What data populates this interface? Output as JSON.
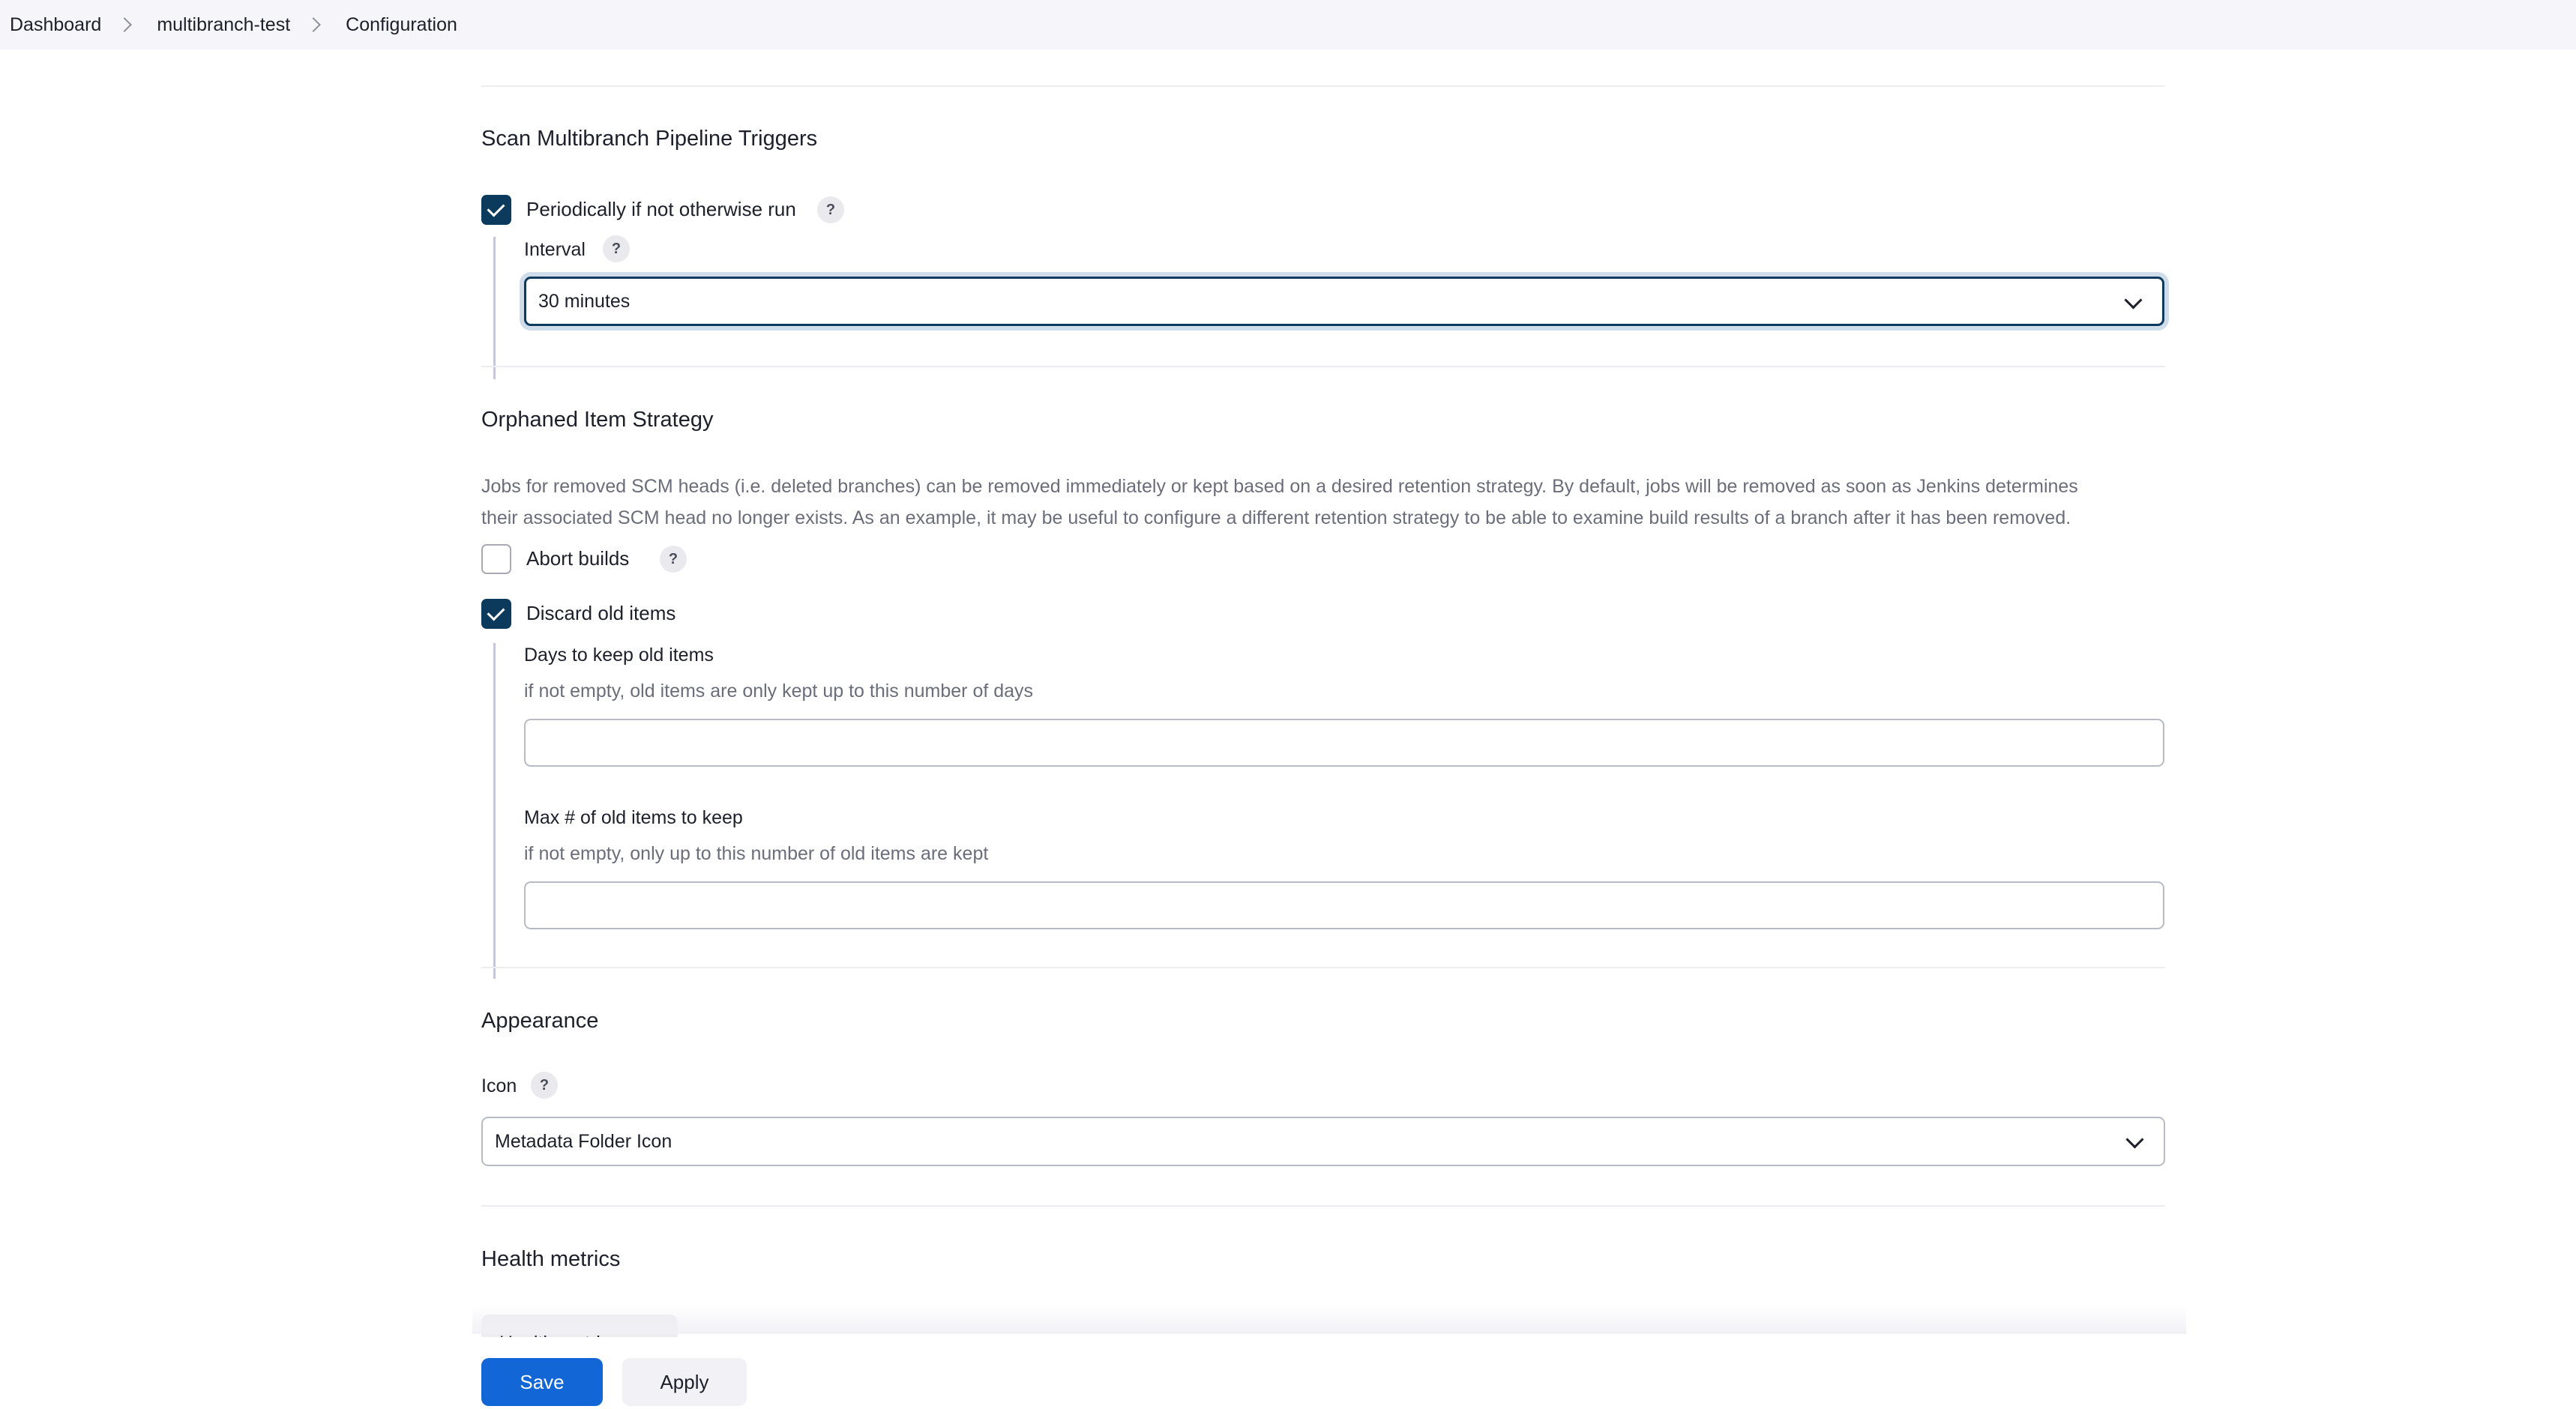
{
  "breadcrumb": {
    "items": [
      "Dashboard",
      "multibranch-test",
      "Configuration"
    ]
  },
  "scan_triggers": {
    "title": "Scan Multibranch Pipeline Triggers",
    "periodic_label": "Periodically if not otherwise run",
    "periodic_checked": true,
    "interval_label": "Interval",
    "interval_value": "30 minutes"
  },
  "orphaned": {
    "title": "Orphaned Item Strategy",
    "description_line1": "Jobs for removed SCM heads (i.e. deleted branches) can be removed immediately or kept based on a desired retention strategy. By default, jobs will be removed as soon as Jenkins determines",
    "description_line2": "their associated SCM head no longer exists. As an example, it may be useful to configure a different retention strategy to be able to examine build results of a branch after it has been removed.",
    "abort_label": "Abort builds",
    "abort_checked": false,
    "discard_label": "Discard old items",
    "discard_checked": true,
    "days_label": "Days to keep old items",
    "days_desc": "if not empty, old items are only kept up to this number of days",
    "days_value": "",
    "max_label": "Max # of old items to keep",
    "max_desc": "if not empty, only up to this number of old items are kept",
    "max_value": ""
  },
  "appearance": {
    "title": "Appearance",
    "icon_label": "Icon",
    "icon_value": "Metadata Folder Icon"
  },
  "health": {
    "title": "Health metrics",
    "button_label": "Health metrics"
  },
  "actions": {
    "save_label": "Save",
    "apply_label": "Apply"
  },
  "help_glyph": "?",
  "colors": {
    "accent": "#0c3a5c",
    "primary_button": "#1366d6",
    "focus_ring": "#cfdce9"
  }
}
